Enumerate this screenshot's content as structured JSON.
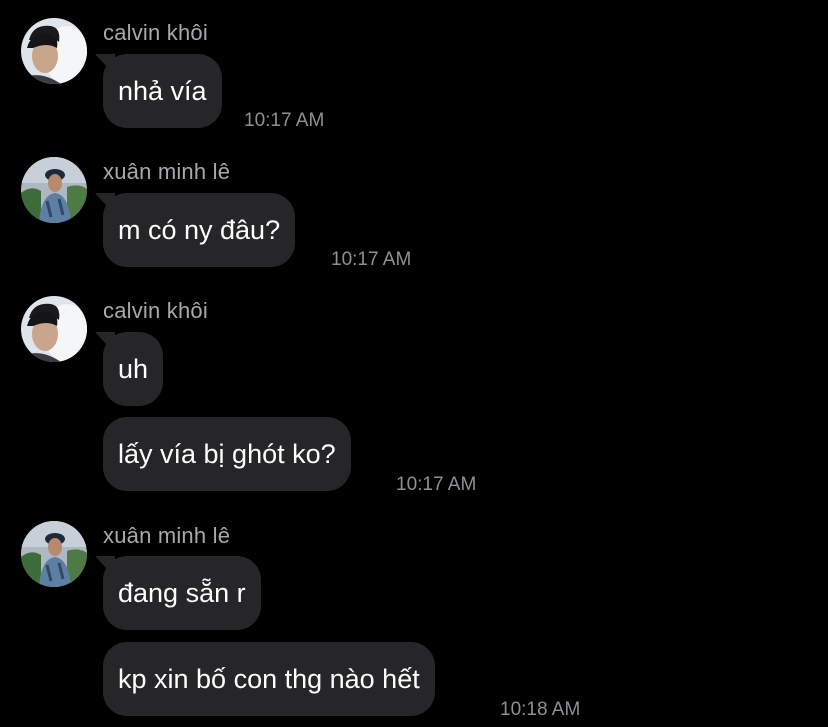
{
  "conversation": {
    "groups": [
      {
        "sender": "calvin khôi",
        "avatar_icon": "person-avatar-icon",
        "messages": [
          "nhả vía"
        ],
        "time": "10:17 AM"
      },
      {
        "sender": "xuân minh lê",
        "avatar_icon": "person-avatar-icon",
        "messages": [
          "m có ny đâu?"
        ],
        "time": "10:17 AM"
      },
      {
        "sender": "calvin khôi",
        "avatar_icon": "person-avatar-icon",
        "messages": [
          "uh",
          "lấy vía bị ghót ko?"
        ],
        "time": "10:17 AM"
      },
      {
        "sender": "xuân minh lê",
        "avatar_icon": "person-avatar-icon",
        "messages": [
          "đang sẵn r",
          "kp xin bố con thg nào hết"
        ],
        "time": "10:18 AM"
      }
    ]
  },
  "colors": {
    "background": "#000000",
    "bubble": "#262628",
    "sender_text": "#a9a9ad",
    "time_text": "#8f8f94",
    "message_text": "#ffffff"
  }
}
